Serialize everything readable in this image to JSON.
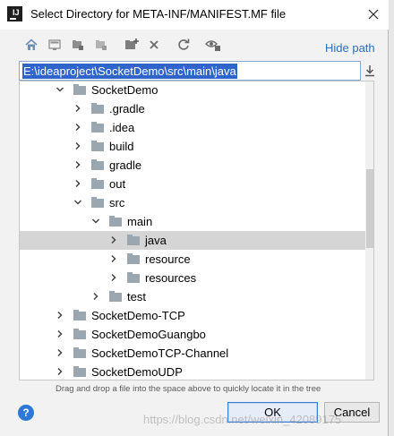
{
  "window": {
    "title": "Select Directory for META-INF/MANIFEST.MF file",
    "app_icon_letter": "IJ"
  },
  "toolbar": {
    "buttons": [
      "home-icon",
      "desktop-icon",
      "module-icon",
      "project-icon",
      "new-folder-icon",
      "delete-icon",
      "refresh-icon",
      "show-hidden-icon"
    ],
    "hide_path_label": "Hide path"
  },
  "path": {
    "value": "E:\\ideaproject\\SocketDemo\\src\\main\\java"
  },
  "tree": {
    "items": [
      {
        "label": "SocketDemo",
        "level": 0,
        "expanded": true
      },
      {
        "label": ".gradle",
        "level": 1,
        "expanded": false
      },
      {
        "label": ".idea",
        "level": 1,
        "expanded": false
      },
      {
        "label": "build",
        "level": 1,
        "expanded": false
      },
      {
        "label": "gradle",
        "level": 1,
        "expanded": false
      },
      {
        "label": "out",
        "level": 1,
        "expanded": false
      },
      {
        "label": "src",
        "level": 1,
        "expanded": true
      },
      {
        "label": "main",
        "level": 2,
        "expanded": true
      },
      {
        "label": "java",
        "level": 3,
        "expanded": false,
        "selected": true
      },
      {
        "label": "resource",
        "level": 3,
        "expanded": false
      },
      {
        "label": "resources",
        "level": 3,
        "expanded": false
      },
      {
        "label": "test",
        "level": 2,
        "expanded": false
      },
      {
        "label": "SocketDemo-TCP",
        "level": -1,
        "expanded": false
      },
      {
        "label": "SocketDemoGuangbo",
        "level": -1,
        "expanded": false
      },
      {
        "label": "SocketDemoTCP-Channel",
        "level": -1,
        "expanded": false
      },
      {
        "label": "SocketDemoUDP",
        "level": -1,
        "expanded": false
      }
    ]
  },
  "hint": "Drag and drop a file into the space above to quickly locate it in the tree",
  "footer": {
    "help_label": "?",
    "ok_label": "OK",
    "cancel_label": "Cancel"
  },
  "watermark": "https://blog.csdn.net/weixin_42089175"
}
